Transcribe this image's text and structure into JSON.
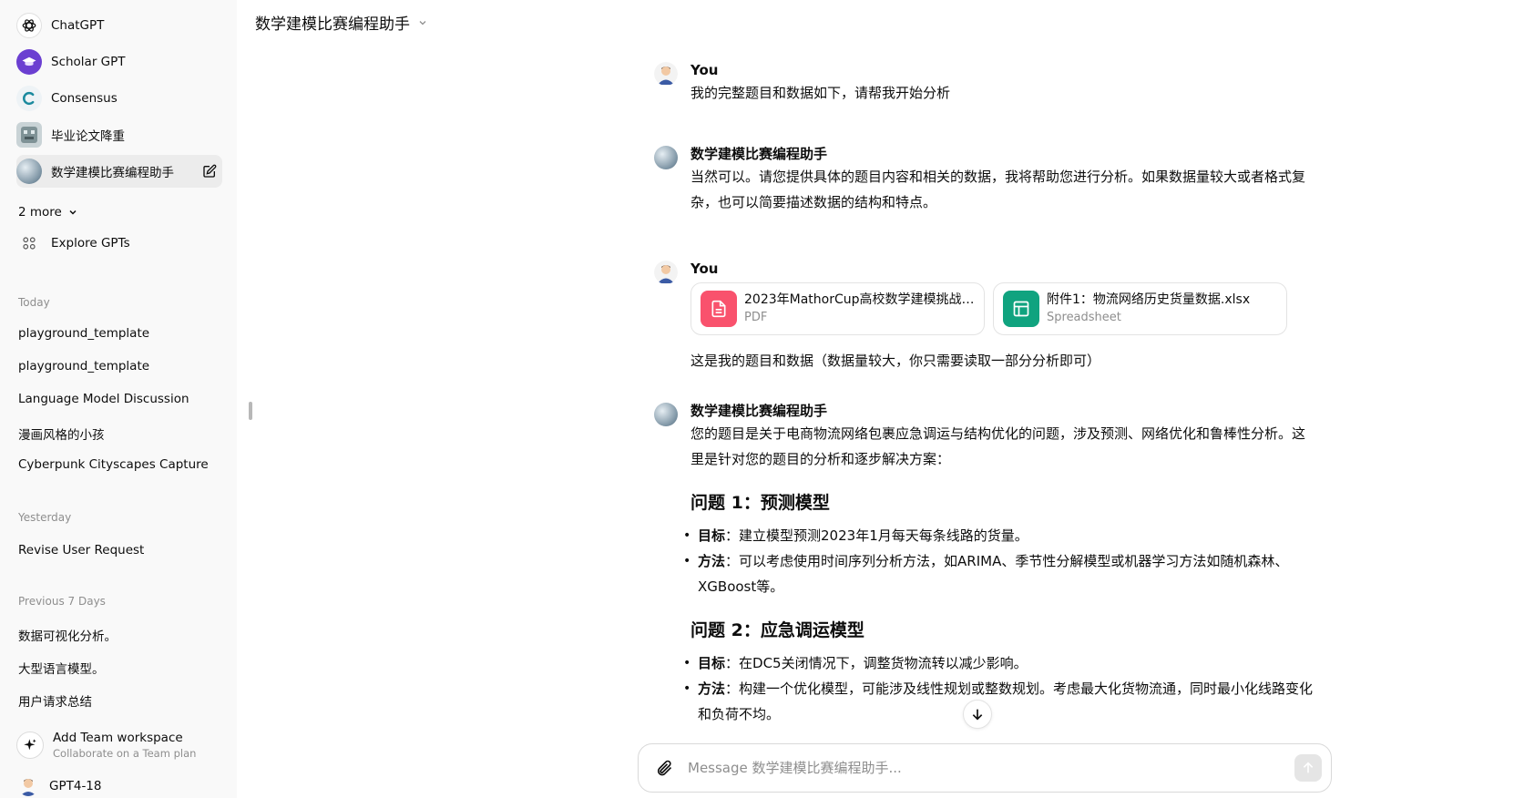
{
  "sidebar": {
    "gpts": [
      {
        "label": "ChatGPT",
        "icon": "openai-logo-icon"
      },
      {
        "label": "Scholar GPT",
        "icon": "scholar-cap-icon"
      },
      {
        "label": "Consensus",
        "icon": "consensus-c-icon"
      },
      {
        "label": "毕业论文降重",
        "icon": "robot-avatar-icon"
      },
      {
        "label": "数学建模比赛编程助手",
        "icon": "gpt-avatar-icon"
      }
    ],
    "more_label": "2 more",
    "explore_label": "Explore GPTs",
    "sections": [
      {
        "title": "Today",
        "items": [
          "playground_template",
          "playground_template",
          "Language Model Discussion",
          "漫画风格的小孩",
          "Cyberpunk Cityscapes Capture"
        ]
      },
      {
        "title": "Yesterday",
        "items": [
          "Revise User Request"
        ]
      },
      {
        "title": "Previous 7 Days",
        "items": [
          "数据可视化分析。",
          "大型语言模型。",
          "用户请求总结"
        ]
      }
    ],
    "team": {
      "title": "Add Team workspace",
      "subtitle": "Collaborate on a Team plan"
    },
    "user": {
      "name": "GPT4-18"
    }
  },
  "header": {
    "title": "数学建模比赛编程助手"
  },
  "conversation": {
    "m1": {
      "author": "You",
      "text": "我的完整题目和数据如下，请帮我开始分析"
    },
    "m2": {
      "author": "数学建模比赛编程助手",
      "text": "当然可以。请您提供具体的题目内容和相关的数据，我将帮助您进行分析。如果数据量较大或者格式复杂，也可以简要描述数据的结构和特点。"
    },
    "m3": {
      "author": "You",
      "files": [
        {
          "name": "2023年MathorCup高校数学建模挑战赛...",
          "type": "PDF",
          "color": "#f9526d"
        },
        {
          "name": "附件1：物流网络历史货量数据.xlsx",
          "type": "Spreadsheet",
          "color": "#10a37f"
        }
      ],
      "text": "这是我的题目和数据（数据量较大，你只需要读取一部分分析即可）"
    },
    "m4": {
      "author": "数学建模比赛编程助手",
      "intro": "您的题目是关于电商物流网络包裹应急调运与结构优化的问题，涉及预测、网络优化和鲁棒性分析。这里是针对您的题目的分析和逐步解决方案：",
      "q1": {
        "heading": "问题 1：预测模型",
        "b1_key": "目标",
        "b1_text": "：建立模型预测2023年1月每天每条线路的货量。",
        "b2_key": "方法",
        "b2_text": "：可以考虑使用时间序列分析方法，如ARIMA、季节性分解模型或机器学习方法如随机森林、XGBoost等。"
      },
      "q2": {
        "heading": "问题 2：应急调运模型",
        "b1_key": "目标",
        "b1_text": "：在DC5关闭情况下，调整货物流转以减少影响。",
        "b2_key": "方法",
        "b2_text": "：构建一个优化模型，可能涉及线性规划或整数规划。考虑最大化货物流通，同时最小化线路变化和负荷不均。"
      }
    }
  },
  "composer": {
    "placeholder": "Message 数学建模比赛编程助手..."
  },
  "colors": {
    "sidebar_bg": "#f9f9f9",
    "pdf_icon": "#f9526d",
    "sheet_icon": "#10a37f",
    "scholar_purple": "#6b3fd1"
  }
}
